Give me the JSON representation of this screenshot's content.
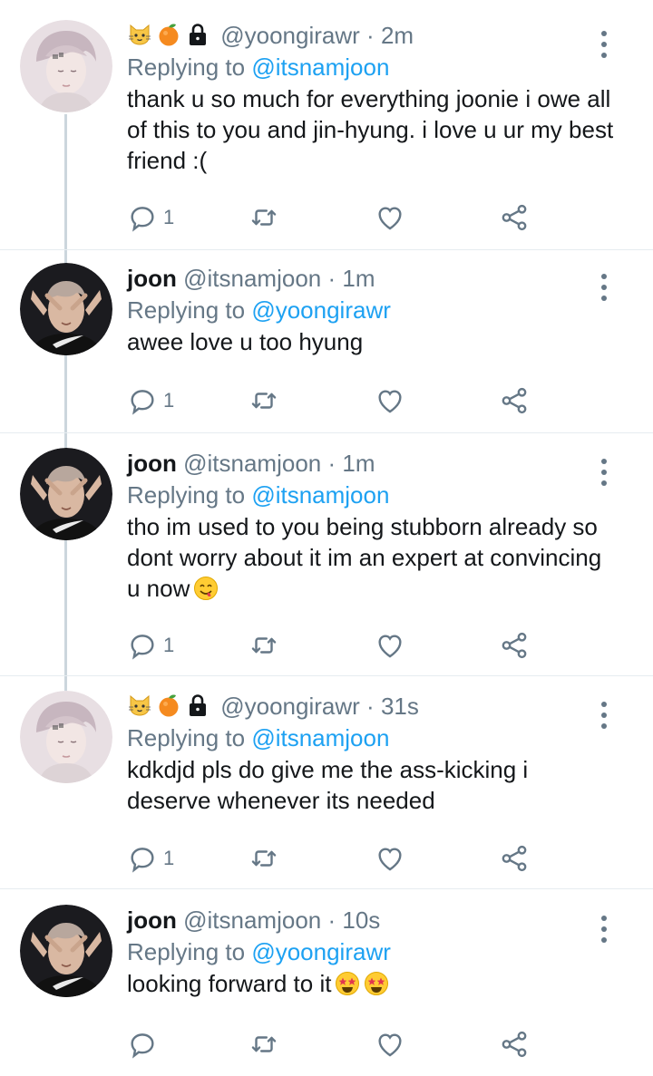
{
  "tweets": [
    {
      "kind": "yoongi",
      "name": "",
      "handle": "@yoongirawr",
      "sep": "·",
      "time": "2m",
      "reply_prefix": "Replying to",
      "reply_to": "@itsnamjoon",
      "text": "thank u so much for everything joonie i owe all of this to you and jin-hyung. i love u ur my best friend :(",
      "emoji_suffix": [],
      "reply_count": "1",
      "header_icons": [
        "cat-face-icon",
        "tangerine-icon",
        "lock-icon"
      ]
    },
    {
      "kind": "joon",
      "name": "joon",
      "handle": "@itsnamjoon",
      "sep": "·",
      "time": "1m",
      "reply_prefix": "Replying to",
      "reply_to": "@yoongirawr",
      "text": "awee love u too hyung",
      "emoji_suffix": [],
      "reply_count": "1"
    },
    {
      "kind": "joon",
      "name": "joon",
      "handle": "@itsnamjoon",
      "sep": "·",
      "time": "1m",
      "reply_prefix": "Replying to",
      "reply_to": "@itsnamjoon",
      "text": "tho im used to you being stubborn already so dont worry about it im an expert at convincing u now",
      "emoji_suffix": [
        "yum-face-emoji"
      ],
      "reply_count": "1"
    },
    {
      "kind": "yoongi",
      "name": "",
      "handle": "@yoongirawr",
      "sep": "·",
      "time": "31s",
      "reply_prefix": "Replying to",
      "reply_to": "@itsnamjoon",
      "text": "kdkdjd pls do give me the ass-kicking i deserve whenever its needed",
      "emoji_suffix": [],
      "reply_count": "1",
      "header_icons": [
        "cat-face-icon",
        "tangerine-icon",
        "lock-icon"
      ]
    },
    {
      "kind": "joon",
      "name": "joon",
      "handle": "@itsnamjoon",
      "sep": "·",
      "time": "10s",
      "reply_prefix": "Replying to",
      "reply_to": "@yoongirawr",
      "text": "looking forward to it",
      "emoji_suffix": [
        "star-struck-emoji",
        "star-struck-emoji"
      ],
      "reply_count": ""
    }
  ],
  "colors": {
    "accent": "#1da1f2",
    "secondary_text": "#657786",
    "primary_text": "#14171a",
    "thread_line": "#ccd6dd"
  }
}
